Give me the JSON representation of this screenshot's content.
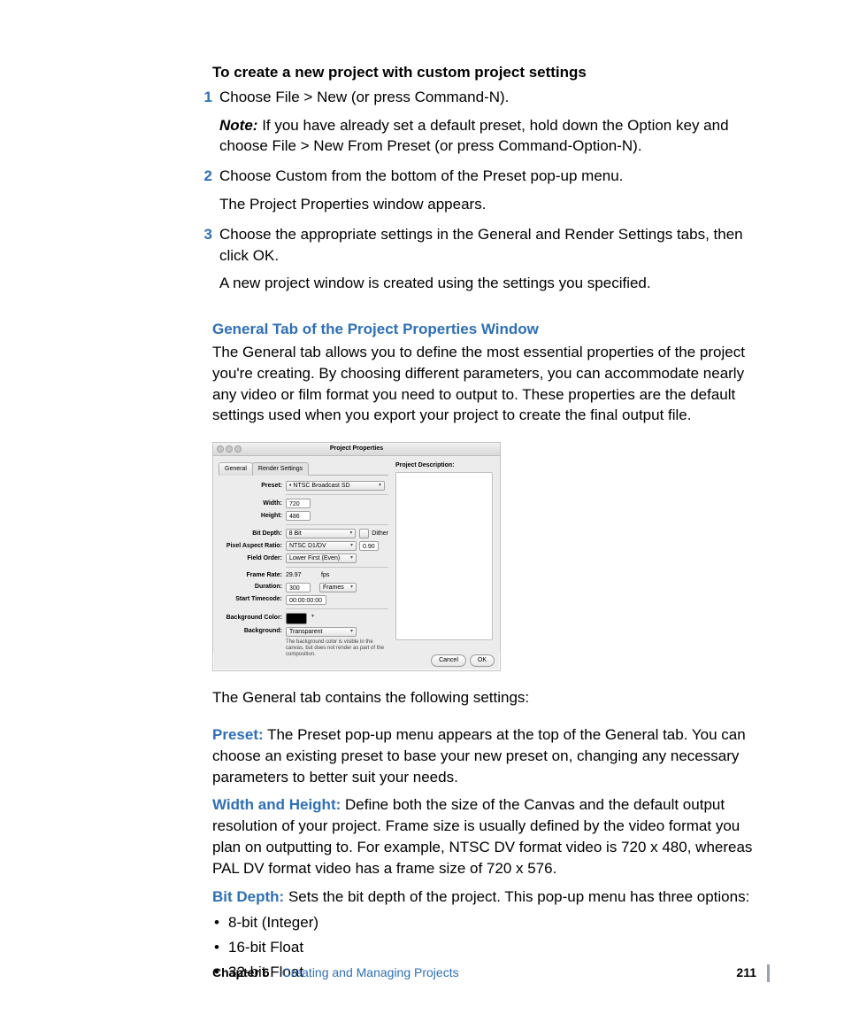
{
  "heading": "To create a new project with custom project settings",
  "steps": [
    {
      "num": "1",
      "text": "Choose File > New (or press Command-N).",
      "note_label": "Note:",
      "note": "If you have already set a default preset, hold down the Option key and choose File > New From Preset (or press Command-Option-N)."
    },
    {
      "num": "2",
      "text": "Choose Custom from the bottom of the Preset pop-up menu.",
      "after": "The Project Properties window appears."
    },
    {
      "num": "3",
      "text": "Choose the appropriate settings in the General and Render Settings tabs, then click OK.",
      "after": "A new project window is created using the settings you specified."
    }
  ],
  "sub_heading": "General Tab of the Project Properties Window",
  "sub_para": "The General tab allows you to define the most essential properties of the project you're creating. By choosing different parameters, you can accommodate nearly any video or film format you need to output to. These properties are the default settings used when you export your project to create the final output file.",
  "after_shot": "The General tab contains the following settings:",
  "defs": [
    {
      "t": "Preset:",
      "b": "The Preset pop-up menu appears at the top of the General tab. You can choose an existing preset to base your new preset on, changing any necessary parameters to better suit your needs."
    },
    {
      "t": "Width and Height:",
      "b": "Define both the size of the Canvas and the default output resolution of your project. Frame size is usually defined by the video format you plan on outputting to. For example, NTSC DV format video is 720 x 480, whereas PAL DV format video has a frame size of 720 x 576."
    },
    {
      "t": "Bit Depth:",
      "b": "Sets the bit depth of the project. This pop-up menu has three options:"
    }
  ],
  "bullets": [
    "8-bit (Integer)",
    "16-bit Float",
    "32-bit Float"
  ],
  "footer": {
    "chapter": "Chapter 6",
    "title": "Creating and Managing Projects",
    "page": "211"
  },
  "shot": {
    "title": "Project Properties",
    "tab_general": "General",
    "tab_render": "Render Settings",
    "desc_label": "Project Description:",
    "fields": {
      "preset": {
        "l": "Preset:",
        "v": "• NTSC Broadcast SD"
      },
      "width": {
        "l": "Width:",
        "v": "720"
      },
      "height": {
        "l": "Height:",
        "v": "486"
      },
      "bit": {
        "l": "Bit Depth:",
        "v": "8 Bit",
        "dither": "Dither"
      },
      "par": {
        "l": "Pixel Aspect Ratio:",
        "v": "NTSC D1/DV",
        "n": "0.90"
      },
      "order": {
        "l": "Field Order:",
        "v": "Lower First (Even)"
      },
      "rate": {
        "l": "Frame Rate:",
        "v": "29.97",
        "u": "fps"
      },
      "dur": {
        "l": "Duration:",
        "v": "300",
        "u": "Frames"
      },
      "tc": {
        "l": "Start Timecode:",
        "v": "00:00:00:00"
      },
      "bgc": {
        "l": "Background Color:"
      },
      "bg": {
        "l": "Background:",
        "v": "Transparent"
      },
      "hint": "The background color is visible in the canvas, but does not render as part of the composition."
    },
    "cancel": "Cancel",
    "ok": "OK"
  }
}
